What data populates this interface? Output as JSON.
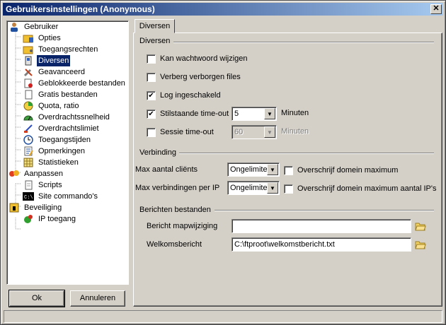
{
  "window": {
    "title": "Gebruikersinstellingen (Anonymous)",
    "close_label": "✕"
  },
  "tree": {
    "items": [
      {
        "label": "Gebruiker",
        "icon": "user-icon"
      },
      {
        "label": "Opties",
        "icon": "folder-options-icon"
      },
      {
        "label": "Toegangsrechten",
        "icon": "folder-key-icon"
      },
      {
        "label": "Diversen",
        "icon": "device-icon",
        "selected": true
      },
      {
        "label": "Geavanceerd",
        "icon": "tools-icon"
      },
      {
        "label": "Geblokkeerde bestanden",
        "icon": "blocked-file-icon"
      },
      {
        "label": "Gratis bestanden",
        "icon": "file-icon"
      },
      {
        "label": "Quota, ratio",
        "icon": "quota-icon"
      },
      {
        "label": "Overdrachtssnelheid",
        "icon": "speed-gauge-icon"
      },
      {
        "label": "Overdrachtslimiet",
        "icon": "limit-icon"
      },
      {
        "label": "Toegangstijden",
        "icon": "clock-icon"
      },
      {
        "label": "Opmerkingen",
        "icon": "notes-icon"
      },
      {
        "label": "Statistieken",
        "icon": "stats-icon"
      },
      {
        "label": "Aanpassen",
        "icon": "customize-icon"
      },
      {
        "label": "Scripts",
        "icon": "script-file-icon"
      },
      {
        "label": "Site commando's",
        "icon": "console-icon"
      },
      {
        "label": "Beveiliging",
        "icon": "security-icon"
      },
      {
        "label": "IP toegang",
        "icon": "ip-access-icon"
      }
    ]
  },
  "buttons": {
    "ok": "Ok",
    "cancel": "Annuleren"
  },
  "tab": {
    "label": "Diversen"
  },
  "diversen": {
    "title": "Diversen",
    "change_password": {
      "label": "Kan wachtwoord wijzigen",
      "checked": false
    },
    "hide_hidden": {
      "label": "Verberg verborgen files",
      "checked": false
    },
    "log_enabled": {
      "label": "Log ingeschakeld",
      "checked": true
    },
    "idle_timeout": {
      "label": "Stilstaande time-out",
      "checked": true,
      "value": "5",
      "unit": "Minuten"
    },
    "session_timeout": {
      "label": "Sessie time-out",
      "checked": false,
      "value": "60",
      "unit": "Minuten"
    }
  },
  "verbinding": {
    "title": "Verbinding",
    "max_clients": {
      "label": "Max aantal cliënts",
      "value": "Ongelimiteerd",
      "override_label": "Overschrijf domein maximum"
    },
    "max_per_ip": {
      "label": "Max verbindingen per IP",
      "value": "Ongelimiteerd",
      "override_label": "Overschrijf domein maximum aantal IP's"
    }
  },
  "berichten": {
    "title": "Berichten bestanden",
    "dir_change": {
      "label": "Bericht mapwijziging",
      "value": ""
    },
    "welcome": {
      "label": "Welkomsbericht",
      "value": "C:\\ftproot\\welkomstbericht.txt"
    }
  }
}
